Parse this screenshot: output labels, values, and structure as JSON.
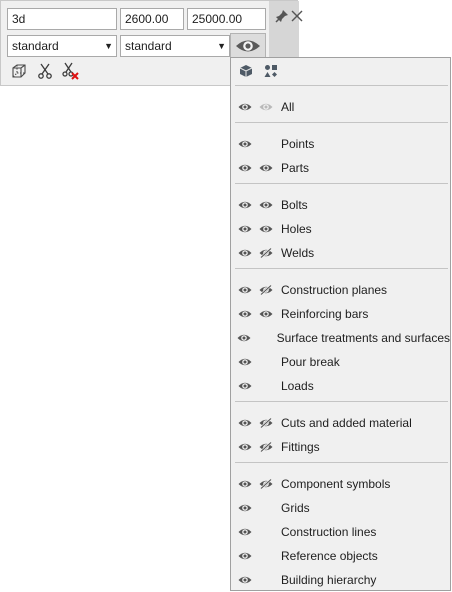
{
  "toolbar": {
    "view_name": "3d",
    "depth_up": "2600.00",
    "depth_down": "25000.00",
    "representation": "standard",
    "visibility": "standard"
  },
  "filter": {
    "groups": [
      [
        {
          "label": "All",
          "eye": true,
          "second": "eye-faded"
        }
      ],
      [
        {
          "label": "Points",
          "eye": true,
          "second": "none"
        },
        {
          "label": "Parts",
          "eye": true,
          "second": "eye"
        }
      ],
      [
        {
          "label": "Bolts",
          "eye": true,
          "second": "eye"
        },
        {
          "label": "Holes",
          "eye": true,
          "second": "eye"
        },
        {
          "label": "Welds",
          "eye": true,
          "second": "eye-off"
        }
      ],
      [
        {
          "label": "Construction planes",
          "eye": true,
          "second": "eye-off"
        },
        {
          "label": "Reinforcing bars",
          "eye": true,
          "second": "eye"
        },
        {
          "label": "Surface treatments and surfaces",
          "eye": true,
          "second": "none"
        },
        {
          "label": "Pour break",
          "eye": true,
          "second": "none"
        },
        {
          "label": "Loads",
          "eye": true,
          "second": "none"
        }
      ],
      [
        {
          "label": "Cuts and added material",
          "eye": true,
          "second": "eye-off"
        },
        {
          "label": "Fittings",
          "eye": true,
          "second": "eye-off"
        }
      ],
      [
        {
          "label": "Component symbols",
          "eye": true,
          "second": "eye-off"
        },
        {
          "label": "Grids",
          "eye": true,
          "second": "none"
        },
        {
          "label": "Construction lines",
          "eye": true,
          "second": "none"
        },
        {
          "label": "Reference objects",
          "eye": true,
          "second": "none"
        },
        {
          "label": "Building hierarchy",
          "eye": true,
          "second": "none"
        }
      ]
    ]
  }
}
